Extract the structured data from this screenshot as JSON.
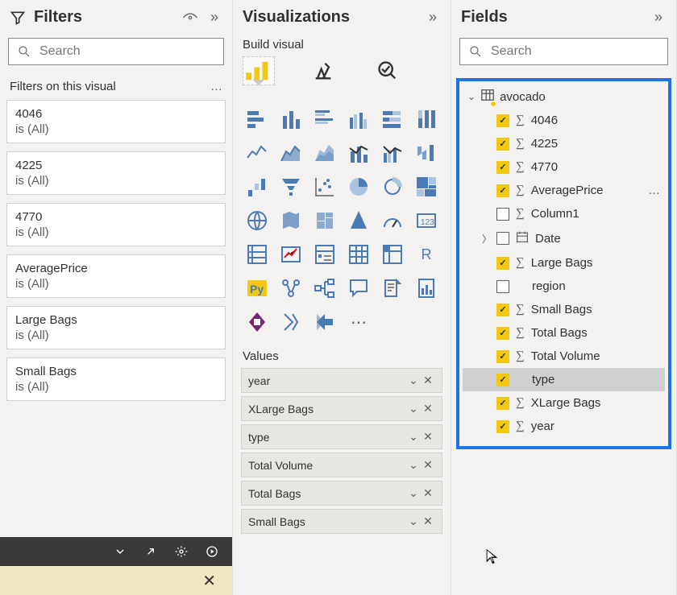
{
  "filters": {
    "title": "Filters",
    "search_placeholder": "Search",
    "section": "Filters on this visual",
    "cards": [
      {
        "name": "4046",
        "sub": "is (All)"
      },
      {
        "name": "4225",
        "sub": "is (All)"
      },
      {
        "name": "4770",
        "sub": "is (All)"
      },
      {
        "name": "AveragePrice",
        "sub": "is (All)"
      },
      {
        "name": "Large Bags",
        "sub": "is (All)"
      },
      {
        "name": "Small Bags",
        "sub": "is (All)"
      }
    ]
  },
  "viz": {
    "title": "Visualizations",
    "build": "Build visual",
    "values_label": "Values",
    "values": [
      {
        "label": "year"
      },
      {
        "label": "XLarge Bags"
      },
      {
        "label": "type"
      },
      {
        "label": "Total Volume"
      },
      {
        "label": "Total Bags"
      },
      {
        "label": "Small Bags"
      }
    ]
  },
  "fields": {
    "title": "Fields",
    "search_placeholder": "Search",
    "table": "avocado",
    "items": [
      {
        "name": "4046",
        "checked": true,
        "sigma": true
      },
      {
        "name": "4225",
        "checked": true,
        "sigma": true
      },
      {
        "name": "4770",
        "checked": true,
        "sigma": true
      },
      {
        "name": "AveragePrice",
        "checked": true,
        "sigma": true,
        "dots": true
      },
      {
        "name": "Column1",
        "checked": false,
        "sigma": true
      },
      {
        "name": "Date",
        "checked": false,
        "date": true,
        "expand": true
      },
      {
        "name": "Large Bags",
        "checked": true,
        "sigma": true
      },
      {
        "name": "region",
        "checked": false,
        "sigma": false
      },
      {
        "name": "Small Bags",
        "checked": true,
        "sigma": true
      },
      {
        "name": "Total Bags",
        "checked": true,
        "sigma": true
      },
      {
        "name": "Total Volume",
        "checked": true,
        "sigma": true
      },
      {
        "name": "type",
        "checked": true,
        "sigma": false,
        "selected": true
      },
      {
        "name": "XLarge Bags",
        "checked": true,
        "sigma": true
      },
      {
        "name": "year",
        "checked": true,
        "sigma": true
      }
    ]
  }
}
